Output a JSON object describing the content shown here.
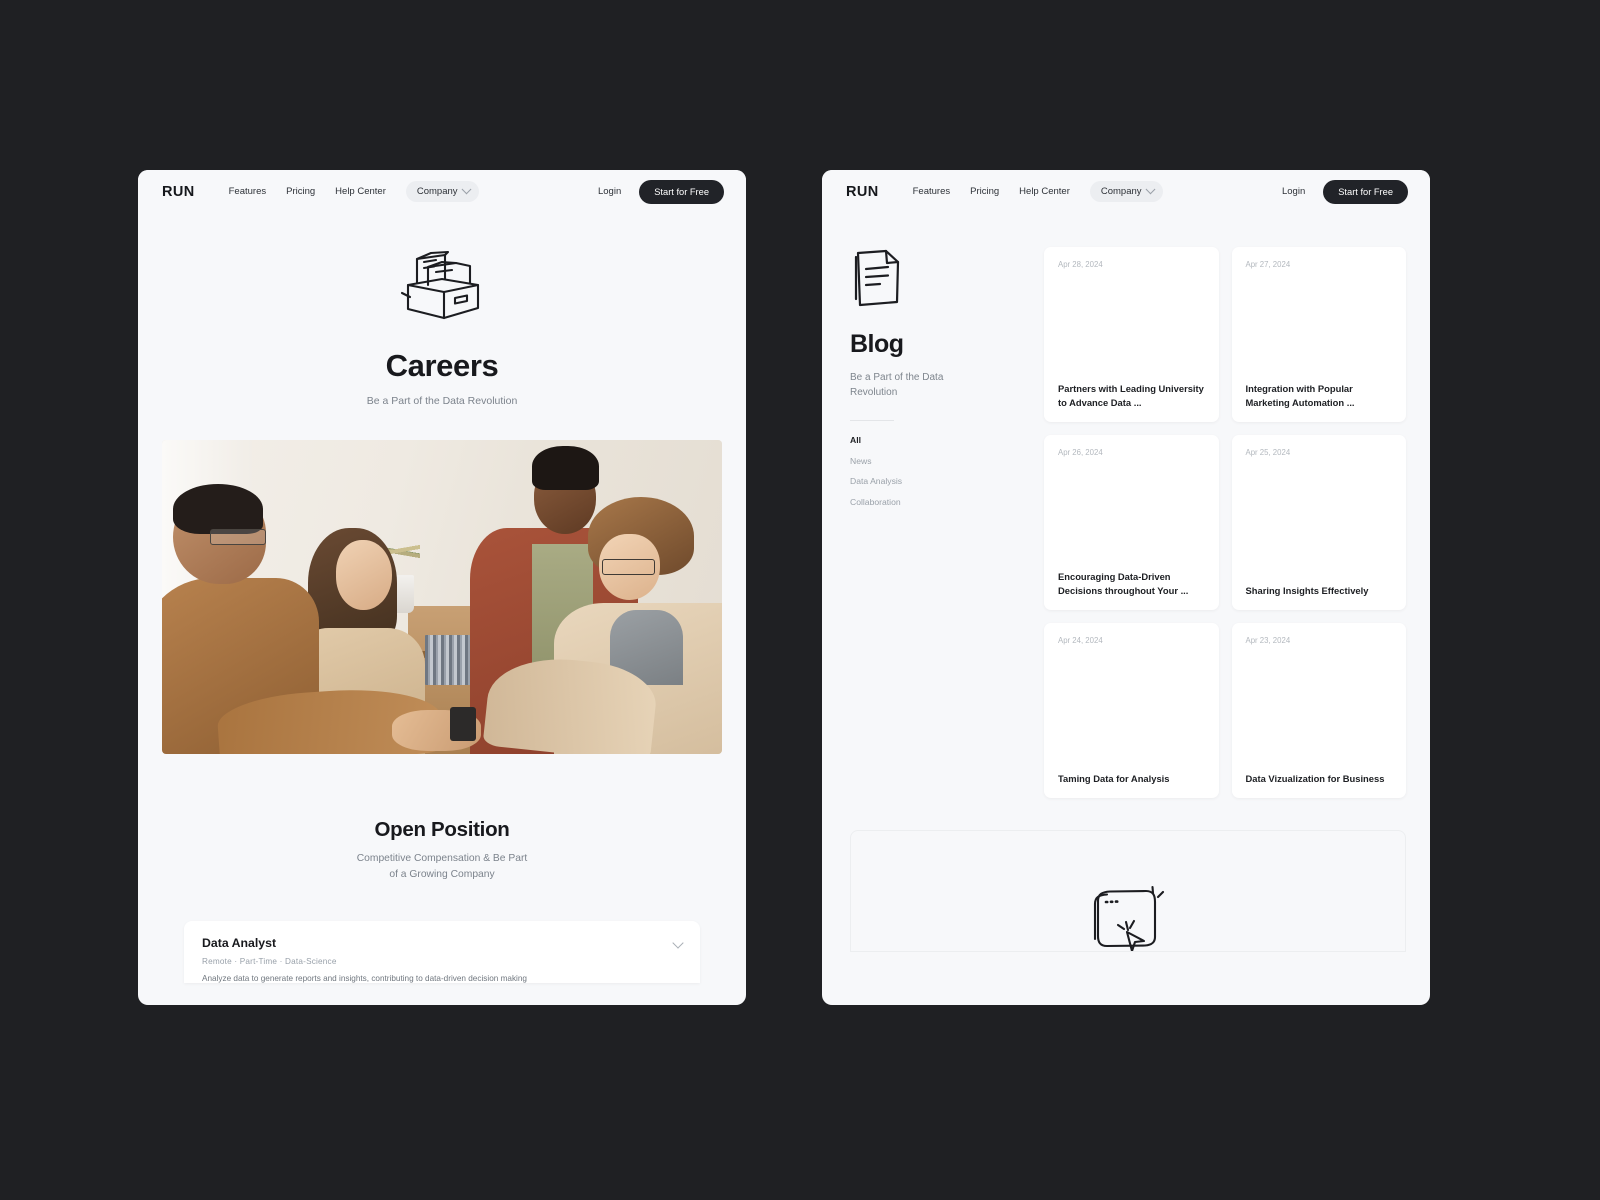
{
  "background_color": "#1f2023",
  "panel_color": "#f7f8fa",
  "accent_dark": "#212328",
  "nav": {
    "brand": "RUN",
    "links": [
      "Features",
      "Pricing",
      "Help Center"
    ],
    "dropdown": "Company",
    "login": "Login",
    "cta": "Start for Free"
  },
  "careers": {
    "hero_icon": "file-drawer-icon",
    "title": "Careers",
    "subtitle": "Be a Part of the Data Revolution",
    "photo_alt": "team-handshake-photo",
    "open_position": {
      "title": "Open Position",
      "subtitle_line1": "Competitive Compensation & Be Part",
      "subtitle_line2": "of a Growing Company",
      "job": {
        "title": "Data Analyst",
        "meta": "Remote  ·  Part-Time  ·  Data-Science",
        "description": "Analyze data to generate reports and insights, contributing to data-driven decision making"
      }
    }
  },
  "blog": {
    "hero_icon": "document-icon",
    "title": "Blog",
    "subtitle": "Be a Part of the Data Revolution",
    "categories": [
      {
        "label": "All",
        "active": true
      },
      {
        "label": "News",
        "active": false
      },
      {
        "label": "Data Analysis",
        "active": false
      },
      {
        "label": "Collaboration",
        "active": false
      }
    ],
    "posts": [
      {
        "date": "Apr 28, 2024",
        "title": "Partners with Leading University to Advance Data ..."
      },
      {
        "date": "Apr 27, 2024",
        "title": "Integration with Popular Marketing Automation ..."
      },
      {
        "date": "Apr 26, 2024",
        "title": "Encouraging Data-Driven Decisions throughout Your ..."
      },
      {
        "date": "Apr 25, 2024",
        "title": "Sharing Insights Effectively"
      },
      {
        "date": "Apr 24, 2024",
        "title": "Taming Data for Analysis"
      },
      {
        "date": "Apr 23, 2024",
        "title": "Data Vizualization for Business"
      }
    ],
    "bottom_icon": "browser-click-icon"
  }
}
